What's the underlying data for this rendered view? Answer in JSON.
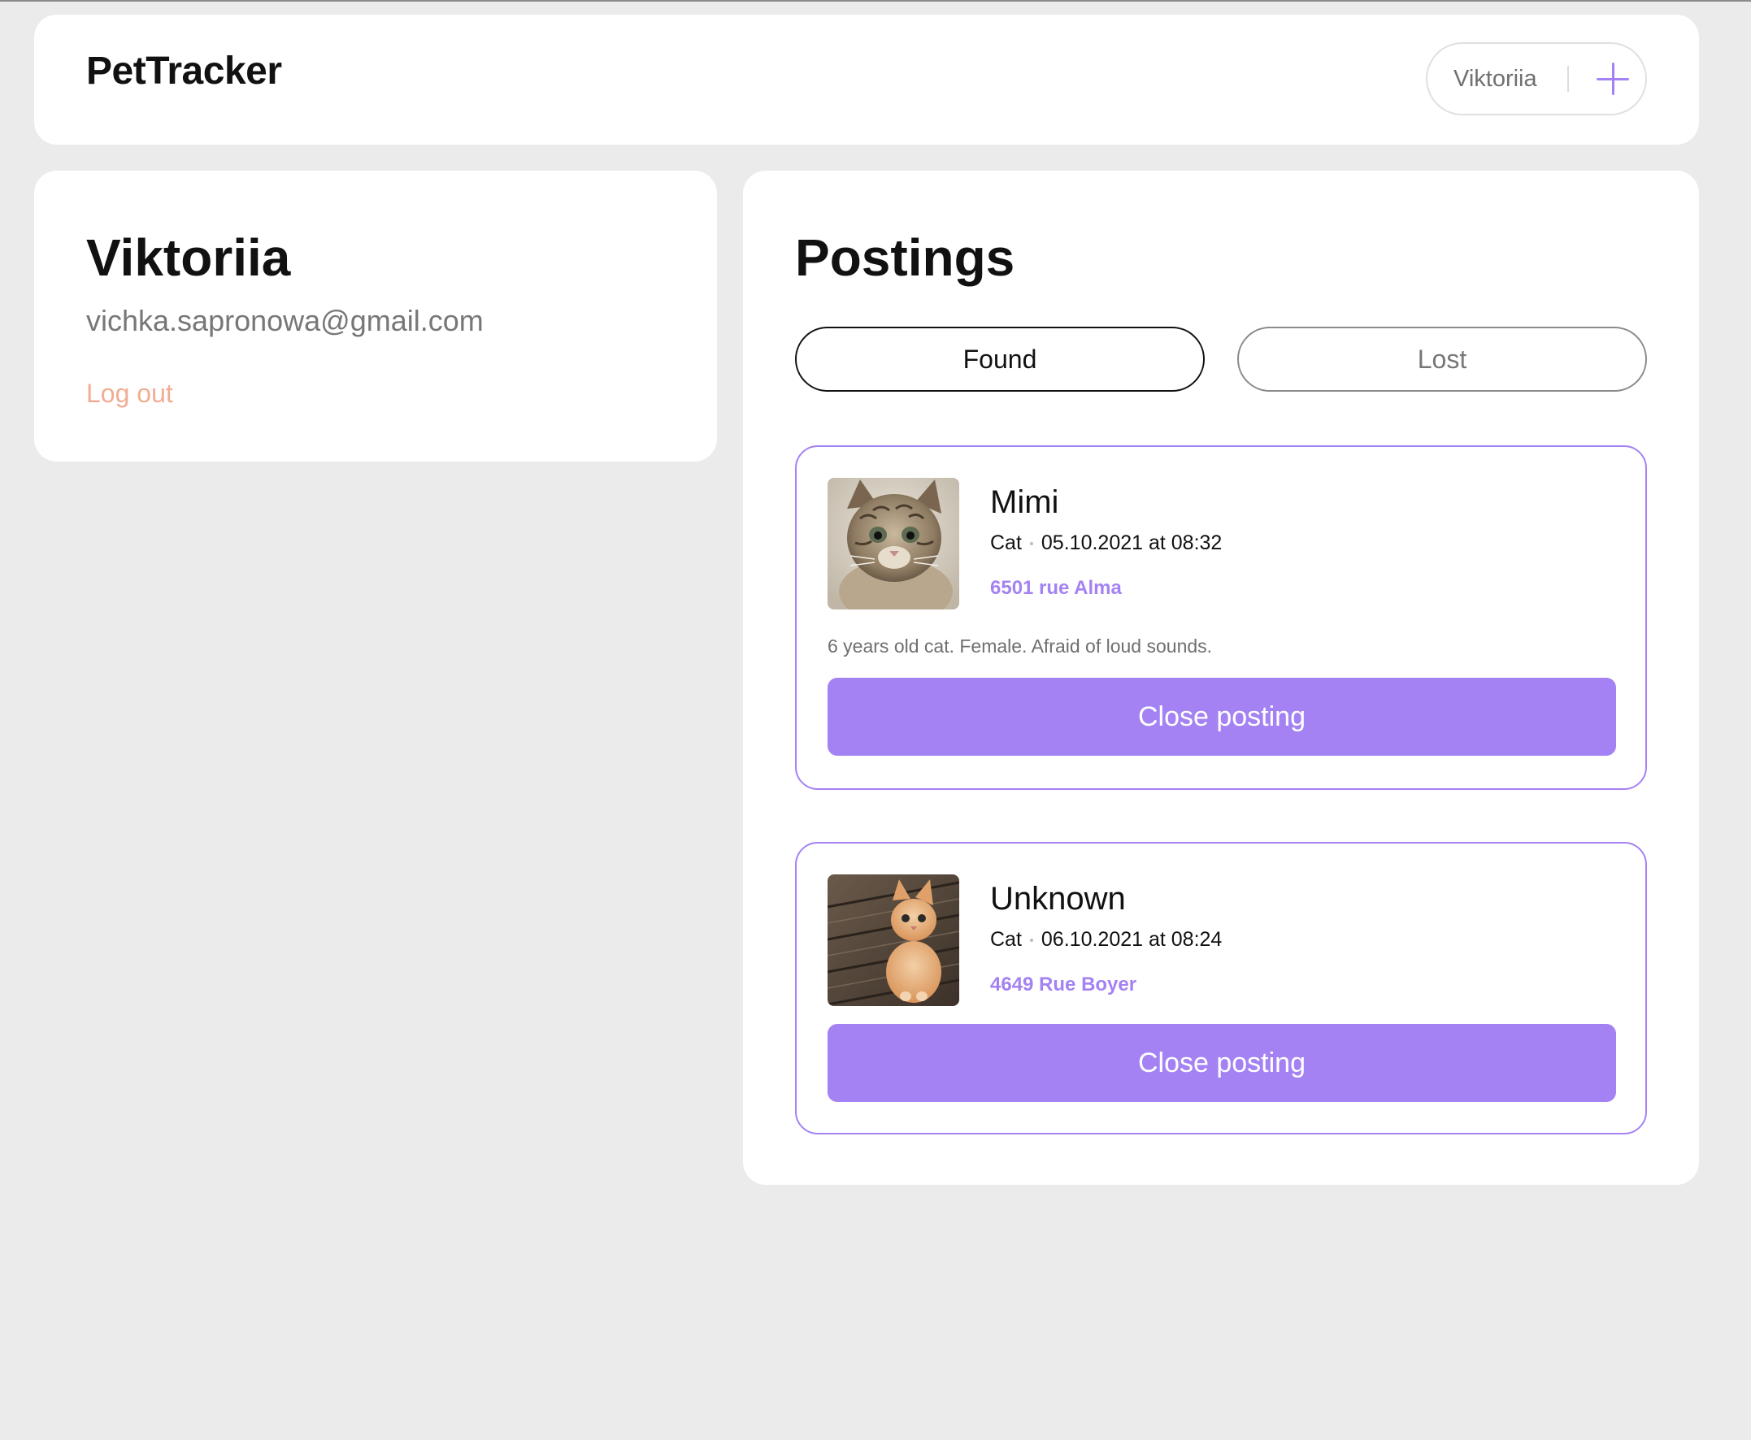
{
  "app": {
    "title": "PetTracker"
  },
  "header": {
    "user_name": "Viktoriia",
    "add_icon": "plus-icon"
  },
  "profile": {
    "name": "Viktoriia",
    "email": "vichka.sapronowa@gmail.com",
    "logout_label": "Log out"
  },
  "postings": {
    "title": "Postings",
    "tabs": [
      {
        "label": "Found",
        "active": true
      },
      {
        "label": "Lost",
        "active": false
      }
    ],
    "items": [
      {
        "name": "Mimi",
        "species": "Cat",
        "datetime": "05.10.2021 at 08:32",
        "address": "6501 rue Alma",
        "description": "6 years old cat. Female. Afraid of loud sounds.",
        "close_label": "Close posting",
        "photo": "tabby-cat-photo"
      },
      {
        "name": "Unknown",
        "species": "Cat",
        "datetime": "06.10.2021 at 08:24",
        "address": "4649 Rue Boyer",
        "close_label": "Close posting",
        "photo": "orange-kitten-photo"
      }
    ]
  },
  "colors": {
    "accent": "#a482f3",
    "logout": "#f1ad93",
    "background": "#ebebeb"
  }
}
